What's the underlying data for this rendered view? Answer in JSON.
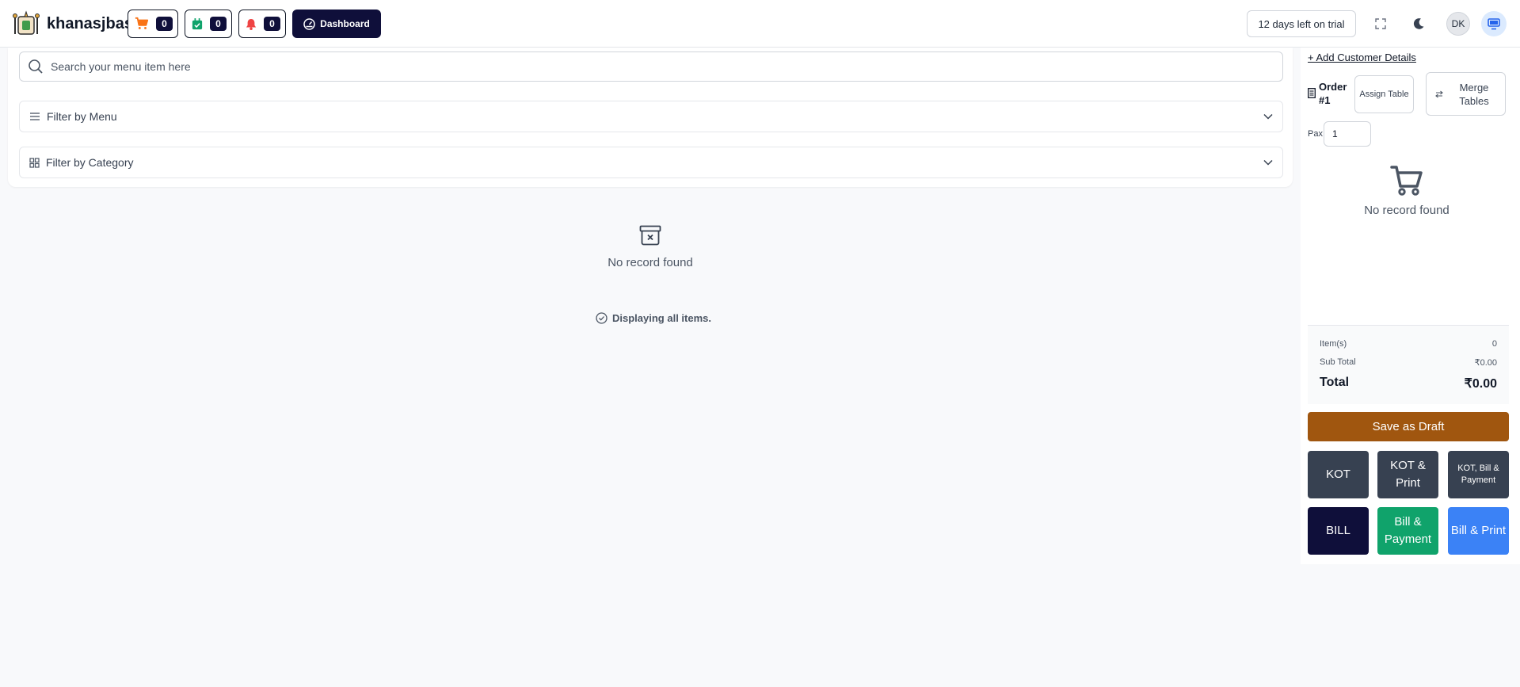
{
  "header": {
    "brand": "khanasjbas",
    "cart_count": "0",
    "orders_count": "0",
    "alerts_count": "0",
    "dashboard_label": "Dashboard",
    "trial_label": "12 days left on trial",
    "avatar_initials": "DK"
  },
  "menu": {
    "search_placeholder": "Search your menu item here",
    "filter_menu_label": "Filter by Menu",
    "filter_category_label": "Filter by Category",
    "empty_text": "No record found",
    "display_all_text": "Displaying all items."
  },
  "order": {
    "add_customer_label": "+ Add Customer Details",
    "order_label": "Order #1",
    "assign_table_label": "Assign Table",
    "merge_tables_label": "Merge Tables",
    "pax_label": "Pax",
    "pax_value": "1",
    "empty_text": "No record found",
    "items_label": "Item(s)",
    "items_value": "0",
    "subtotal_label": "Sub Total",
    "subtotal_value": "₹0.00",
    "total_label": "Total",
    "total_value": "₹0.00",
    "save_draft_label": "Save as Draft"
  },
  "actions": [
    {
      "label": "KOT",
      "color": "#374151"
    },
    {
      "label": "KOT & Print",
      "color": "#374151"
    },
    {
      "label": "KOT, Bill & Payment",
      "color": "#374151"
    },
    {
      "label": "BILL",
      "color": "#0f0f3a"
    },
    {
      "label": "Bill & Payment",
      "color": "#10a36b"
    },
    {
      "label": "Bill & Print",
      "color": "#3b82f6"
    }
  ],
  "colors": {
    "accent_dark": "#0f0f3a",
    "draft_button": "#a0560f",
    "cart_icon": "#f97316",
    "orders_icon": "#10a36b",
    "alerts_icon": "#ef4444"
  }
}
